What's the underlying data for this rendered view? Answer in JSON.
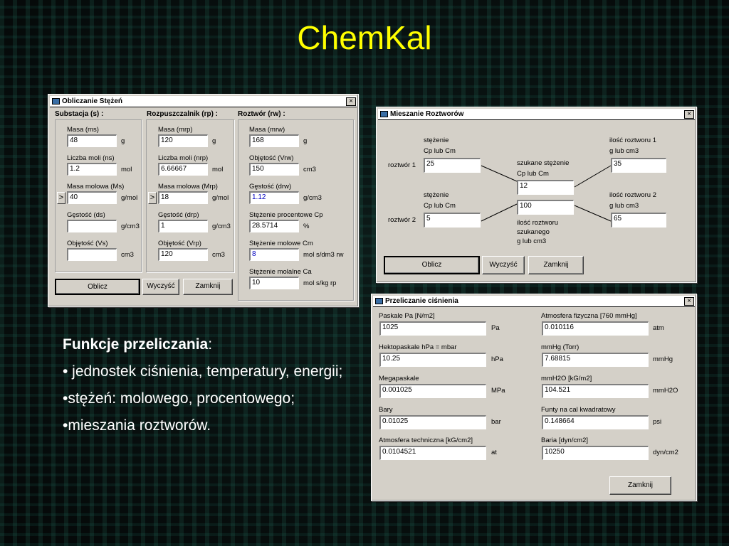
{
  "slide": {
    "title": "ChemKal",
    "heading_bold": "Funkcje przeliczania",
    "heading_colon": ":",
    "bullets": [
      "• jednostek ciśnienia, temperatury, energii;",
      "•stężeń: molowego, procentowego;",
      "•mieszania roztworów."
    ]
  },
  "stezen": {
    "title": "Obliczanie Stężeń",
    "close": "×",
    "sections": {
      "s": "Substacja  (s) :",
      "rp": "Rozpuszczalnik  (rp) :",
      "rw": "Roztwór  (rw) :"
    },
    "s": {
      "masa_label": "Masa (ms)",
      "masa_value": "48",
      "masa_unit": "g",
      "moli_label": "Liczba moli (ns)",
      "moli_value": "1.2",
      "moli_unit": "mol",
      "molowa_label": "Masa molowa (Ms)",
      "molowa_value": "40",
      "molowa_unit": "g/mol",
      "gestosc_label": "Gęstość (ds)",
      "gestosc_value": "",
      "gestosc_unit": "g/cm3",
      "objetosc_label": "Objętość (Vs)",
      "objetosc_value": "",
      "objetosc_unit": "cm3"
    },
    "rp": {
      "masa_label": "Masa (mrp)",
      "masa_value": "120",
      "masa_unit": "g",
      "moli_label": "Liczba moli (nrp)",
      "moli_value": "6.66667",
      "moli_unit": "mol",
      "molowa_label": "Masa molowa (Mrp)",
      "molowa_value": "18",
      "molowa_unit": "g/mol",
      "gestosc_label": "Gęstość (drp)",
      "gestosc_value": "1",
      "gestosc_unit": "g/cm3",
      "objetosc_label": "Objętość (Vrp)",
      "objetosc_value": "120",
      "objetosc_unit": "cm3"
    },
    "rw": {
      "masa_label": "Masa (mrw)",
      "masa_value": "168",
      "masa_unit": "g",
      "objetosc_label": "Objętość (Vrw)",
      "objetosc_value": "150",
      "objetosc_unit": "cm3",
      "gestosc_label": "Gęstość (drw)",
      "gestosc_value": "1.12",
      "gestosc_unit": "g/cm3",
      "proc_label": "Stężenie procentowe Cp",
      "proc_value": "28.5714",
      "proc_unit": "%",
      "molowe_label": "Stężenie molowe Cm",
      "molowe_value": "8",
      "molowe_unit": "mol s/dm3 rw",
      "molalne_label": "Stężenie molalne Ca",
      "molalne_value": "10",
      "molalne_unit": "mol s/kg rp"
    },
    "arrow": ">",
    "buttons": {
      "oblicz": "Oblicz",
      "wyczysc": "Wyczyść",
      "zamknij": "Zamknij"
    },
    "colors": {
      "computed_text": "#0000c0"
    }
  },
  "mieszanie": {
    "title": "Mieszanie Roztworów",
    "close": "×",
    "stezenie_label_1": "stężenie",
    "stezenie_label_2": "Cp lub Cm",
    "roztwor1_label": "roztwór 1",
    "roztwor1_value": "25",
    "roztwor2_label": "roztwór 2",
    "roztwor2_value": "5",
    "szukane_label_1": "szukane stężenie",
    "szukane_label_2": "Cp lub Cm",
    "szukane_value": "12",
    "ilosc_szukanego_value": "100",
    "ilosc_szukanego_label_1": "ilość roztworu",
    "ilosc_szukanego_label_2": "szukanego",
    "ilosc_szukanego_label_3": "g lub cm3",
    "ilosc1_label_1": "ilość roztworu 1",
    "ilosc1_label_2": "g lub cm3",
    "ilosc1_value": "35",
    "ilosc2_label_1": "ilość roztworu 2",
    "ilosc2_label_2": "g lub cm3",
    "ilosc2_value": "65",
    "buttons": {
      "oblicz": "Oblicz",
      "wyczysc": "Wyczyść",
      "zamknij": "Zamknij"
    }
  },
  "cisnienie": {
    "title": "Przeliczanie ciśnienia",
    "close": "×",
    "left": [
      {
        "label": "Paskale   Pa [N/m2]",
        "value": "1025",
        "unit": "Pa"
      },
      {
        "label": "Hektopaskale   hPa = mbar",
        "value": "10.25",
        "unit": "hPa"
      },
      {
        "label": "Megapaskale",
        "value": "0.001025",
        "unit": "MPa"
      },
      {
        "label": "Bary",
        "value": "0.01025",
        "unit": "bar"
      },
      {
        "label": "Atmosfera techniczna   [kG/cm2]",
        "value": "0.0104521",
        "unit": "at"
      }
    ],
    "right": [
      {
        "label": "Atmosfera fizyczna   [760 mmHg]",
        "value": "0.010116",
        "unit": "atm"
      },
      {
        "label": "mmHg  (Torr)",
        "value": "7.68815",
        "unit": "mmHg"
      },
      {
        "label": "mmH2O [kG/m2]",
        "value": "104.521",
        "unit": "mmH2O"
      },
      {
        "label": "Funty na cal kwadratowy",
        "value": "0.148664",
        "unit": "psi"
      },
      {
        "label": "Baria   [dyn/cm2]",
        "value": "10250",
        "unit": "dyn/cm2"
      }
    ],
    "buttons": {
      "zamknij": "Zamknij"
    }
  }
}
